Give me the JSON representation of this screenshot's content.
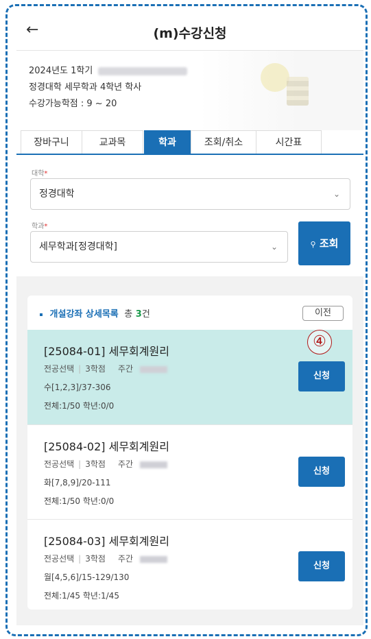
{
  "header": {
    "back_icon": "arrow-left-icon",
    "title": "(m)수강신청"
  },
  "info": {
    "line1": "2024년도 1학기",
    "line2": "정경대학 세무학과 4학년 학사",
    "line3": "수강가능학점 : 9 ~ 20"
  },
  "tabs": [
    {
      "label": "장바구니"
    },
    {
      "label": "교과목"
    },
    {
      "label": "학과"
    },
    {
      "label": "조회/취소"
    },
    {
      "label": "시간표"
    }
  ],
  "filter": {
    "college_label": "대학",
    "college_value": "정경대학",
    "dept_label": "학과",
    "dept_value": "세무학과[정경대학]",
    "required_mark": "*",
    "search_label": "조회",
    "search_icon": "search-icon"
  },
  "list": {
    "title": "개설강좌 상세목록",
    "count_label": "총",
    "count": "3",
    "count_unit": "건",
    "prev_label": "이전",
    "courses": [
      {
        "name": "[25084-01] 세무회계원리",
        "type": "전공선택",
        "credits": "3학점",
        "shift": "주간",
        "time": "수[1,2,3]/37-306",
        "capacity": "전체:1/50 학년:0/0",
        "apply_label": "신청"
      },
      {
        "name": "[25084-02] 세무회계원리",
        "type": "전공선택",
        "credits": "3학점",
        "shift": "주간",
        "time": "화[7,8,9]/20-111",
        "capacity": "전체:1/50 학년:0/0",
        "apply_label": "신청"
      },
      {
        "name": "[25084-03] 세무회계원리",
        "type": "전공선택",
        "credits": "3학점",
        "shift": "주간",
        "time": "월[4,5,6]/15-129/130",
        "capacity": "전체:1/45 학년:1/45",
        "apply_label": "신청"
      }
    ]
  },
  "marker": "④",
  "colors": {
    "primary": "#1a6fb5",
    "selected_row": "#c9ebe9",
    "frame": "#1a6fb5"
  }
}
